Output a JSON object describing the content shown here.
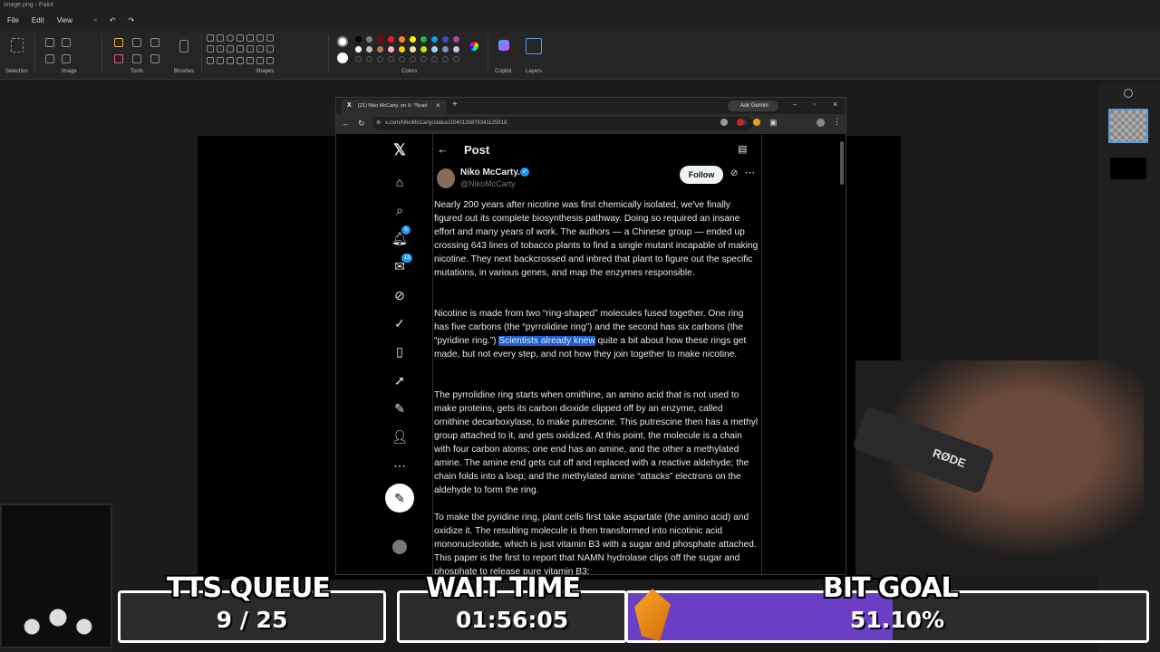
{
  "paint": {
    "title": "image.png - Paint",
    "menu": [
      "File",
      "Edit",
      "View"
    ],
    "ribbon_groups": [
      "Selection",
      "Image",
      "Tools",
      "Brushes",
      "Shapes",
      "Colors",
      "Copilot",
      "Layers"
    ]
  },
  "browser": {
    "tab_title": "(21) Niko McCarty. on X: \"Nearl",
    "url": "x.com/NikoMcCarty/status/2040126879341125918",
    "ask_gemini": "Ask Gemini"
  },
  "x": {
    "header_title": "Post",
    "notification_badge": "6",
    "messages_badge": "13",
    "author_name": "Niko McCarty.",
    "author_handle": "@NikoMcCarty",
    "follow_label": "Follow",
    "paragraphs": [
      "Nearly 200 years after nicotine was first chemically isolated, we've finally figured out its complete biosynthesis pathway. Doing so required an insane effort and many years of work. The authors — a Chinese group — ended up crossing 643 lines of tobacco plants to find a single mutant incapable of making nicotine. They next backcrossed and inbred that plant to figure out the specific mutations, in various genes, and map the enzymes responsible.",
      "The pyrrolidine ring starts when ornithine, an amino acid that is not used to make proteins, gets its carbon dioxide clipped off by an enzyme, called ornithine decarboxylase, to make putrescine. This putrescine then has a methyl group attached to it, and gets oxidized. At this point, the molecule is a chain with four carbon atoms; one end has an amine, and the other a methylated amine. The amine end gets cut off and replaced with a reactive aldehyde; the chain folds into a loop; and the methylated amine “attacks” electrons on the aldehyde to form the ring.",
      "To make the pyridine ring, plant cells first take aspartate (the amino acid) and oxidize it. The resulting molecule is then transformed into nicotinic acid mononucleotide, which is just vitamin B3 with a sugar and phosphate attached. This paper is the first to report that NAMN hydrolase clips off the sugar and phosphate to release pure vitamin B3;"
    ],
    "para2_before": "Nicotine is made from two “ring-shaped” molecules fused together. One ring has five carbons (the “pyrrolidine ring”) and the second has six carbons (the “pyridine ring.”) ",
    "para2_highlight": "Scientists already knew",
    "para2_after": " quite a bit about how these rings get made, but not every step, and not how they join together to make nicotine."
  },
  "overlay": {
    "tts_title": "TTS QUEUE",
    "tts_value": "9 / 25",
    "wait_title": "WAIT TIME",
    "wait_value": "01:56:05",
    "bit_title": "BIT GOAL",
    "bit_value": "51.10%",
    "bit_progress": 0.511,
    "mic_brand": "RØDE"
  },
  "colors": {
    "x_blue": "#1d9bf0",
    "highlight": "#1a5fd1",
    "bit_bar": "#6a3fc4"
  }
}
